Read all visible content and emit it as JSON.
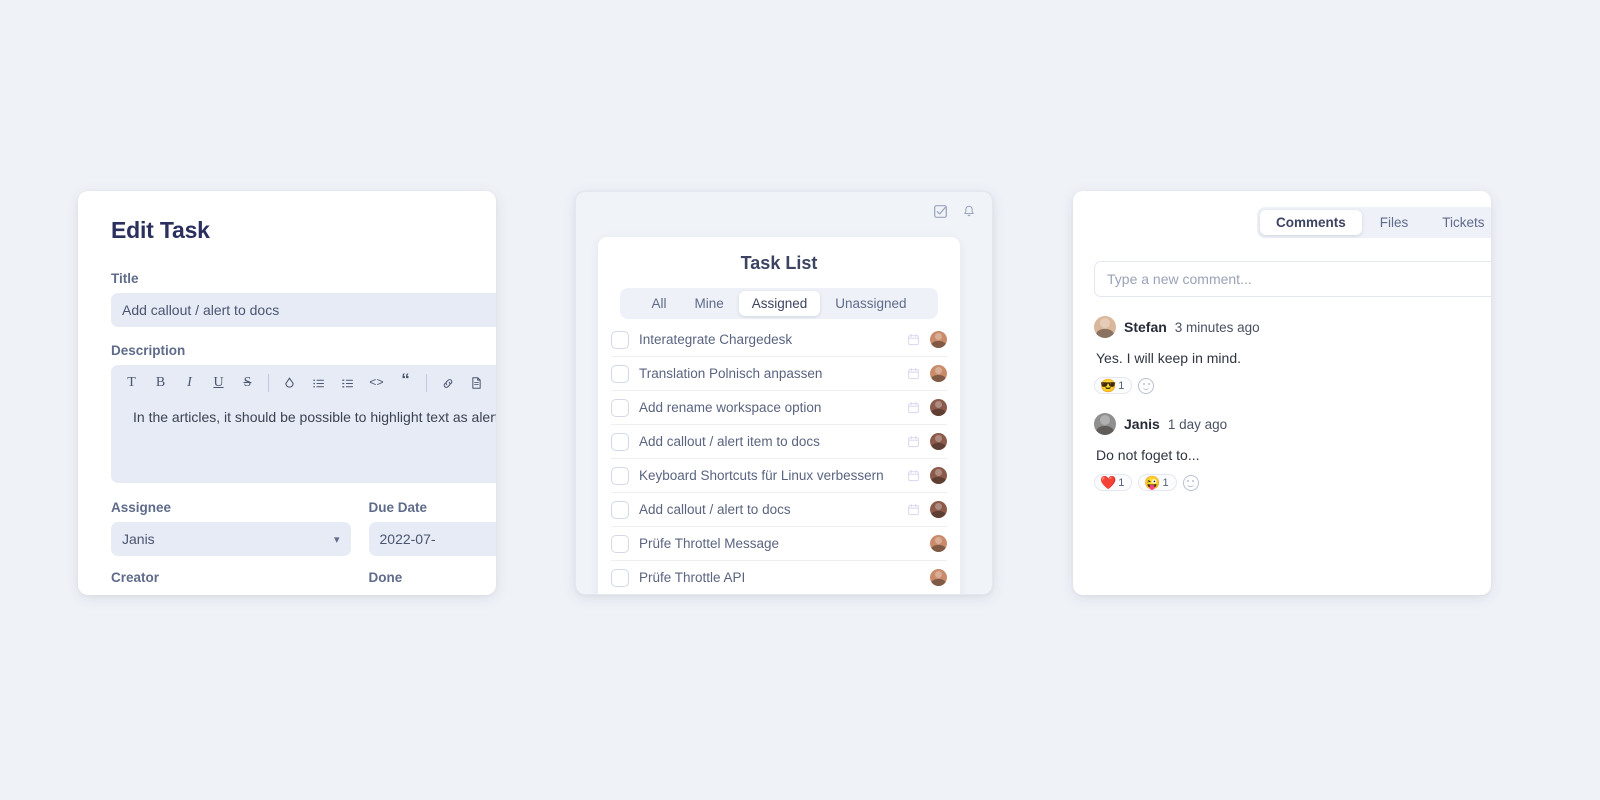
{
  "theme": {
    "page_bg": "#eff2f7",
    "card_bg": "#ffffff",
    "field_bg": "#e7ebf5",
    "heading_color": "#2b2f5e",
    "muted_text": "#5f6b8a"
  },
  "edit_task": {
    "heading": "Edit Task",
    "title_label": "Title",
    "title_value": "Add callout / alert to docs",
    "description_label": "Description",
    "description_value": "In the articles, it should be possible to highlight text as alert o",
    "toolbar": [
      {
        "name": "text-icon",
        "glyph": "T"
      },
      {
        "name": "bold-icon",
        "glyph": "B"
      },
      {
        "name": "italic-icon",
        "glyph": "I"
      },
      {
        "name": "underline-icon",
        "glyph": "U"
      },
      {
        "name": "strikethrough-icon",
        "glyph": "S"
      },
      {
        "name": "divider",
        "glyph": ""
      },
      {
        "name": "highlight-icon",
        "glyph": "◇"
      },
      {
        "name": "bullet-list-icon",
        "glyph": ""
      },
      {
        "name": "numbered-list-icon",
        "glyph": ""
      },
      {
        "name": "code-icon",
        "glyph": "<>"
      },
      {
        "name": "quote-icon",
        "glyph": "“"
      },
      {
        "name": "divider",
        "glyph": ""
      },
      {
        "name": "link-icon",
        "glyph": ""
      },
      {
        "name": "document-icon",
        "glyph": ""
      }
    ],
    "assignee_label": "Assignee",
    "assignee_value": "Janis",
    "due_date_label": "Due Date",
    "due_date_value": "2022-07-",
    "creator_label": "Creator",
    "done_label": "Done"
  },
  "task_list": {
    "header_icons": [
      "task-check-icon",
      "bell-icon"
    ],
    "title": "Task List",
    "filters": [
      {
        "label": "All",
        "active": false
      },
      {
        "label": "Mine",
        "active": false
      },
      {
        "label": "Assigned",
        "active": true
      },
      {
        "label": "Unassigned",
        "active": false
      }
    ],
    "tasks": [
      {
        "label": "Interategrate Chargedesk",
        "has_due_date": true,
        "avatar": "#c98b6a"
      },
      {
        "label": "Translation Polnisch anpassen",
        "has_due_date": true,
        "avatar": "#c98b6a"
      },
      {
        "label": "Add rename workspace option",
        "has_due_date": true,
        "avatar": "#8c5a4a"
      },
      {
        "label": "Add callout / alert item to docs",
        "has_due_date": true,
        "avatar": "#8c5a4a"
      },
      {
        "label": "Keyboard Shortcuts für Linux verbessern",
        "has_due_date": true,
        "avatar": "#8c5a4a"
      },
      {
        "label": "Add callout / alert to docs",
        "has_due_date": true,
        "avatar": "#8c5a4a"
      },
      {
        "label": "Prüfe Throttel Message",
        "has_due_date": false,
        "avatar": "#c98b6a"
      },
      {
        "label": "Prüfe Throttle API",
        "has_due_date": false,
        "avatar": "#c98b6a"
      }
    ]
  },
  "comments_panel": {
    "tabs": [
      {
        "label": "Comments",
        "active": true
      },
      {
        "label": "Files",
        "active": false
      },
      {
        "label": "Tickets",
        "active": false
      }
    ],
    "input_placeholder": "Type a new comment...",
    "comments": [
      {
        "author": "Stefan",
        "time": "3 minutes ago",
        "text": "Yes. I will keep in mind.",
        "avatar_tone": "#d9b79a",
        "reactions": [
          {
            "emoji": "😎",
            "count": "1"
          }
        ]
      },
      {
        "author": "Janis",
        "time": "1 day ago",
        "text": "Do not foget to...",
        "avatar_tone": "#8f8f8f",
        "reactions": [
          {
            "emoji": "❤️",
            "count": "1"
          },
          {
            "emoji": "😜",
            "count": "1"
          }
        ]
      }
    ]
  }
}
